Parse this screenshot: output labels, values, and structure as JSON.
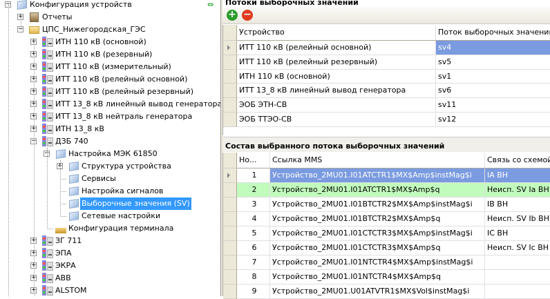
{
  "tree": {
    "nodes": [
      {
        "label": "Конфигурация устройств",
        "level": 0,
        "expander": "−",
        "icon": "cube-icon"
      },
      {
        "label": "Отчеты",
        "level": 1,
        "expander": "+",
        "icon": "reports-icon"
      },
      {
        "label": "ЦПС_Нижегородская_ГЭС",
        "level": 1,
        "expander": "−",
        "icon": "folder-icon"
      },
      {
        "label": "ИТН 110 кВ (основной)",
        "level": 2,
        "expander": "+",
        "icon": "device-icon"
      },
      {
        "label": "ИТН 110 кВ (резервный)",
        "level": 2,
        "expander": "+",
        "icon": "device-icon"
      },
      {
        "label": "ИТТ 110 кВ (измерительный)",
        "level": 2,
        "expander": "+",
        "icon": "device-icon"
      },
      {
        "label": "ИТТ 110 кВ (релейный основной)",
        "level": 2,
        "expander": "+",
        "icon": "device-icon"
      },
      {
        "label": "ИТТ 110 кВ (релейный резервный)",
        "level": 2,
        "expander": "+",
        "icon": "device-icon"
      },
      {
        "label": "ИТТ 13_8 кВ линейный вывод генератора",
        "level": 2,
        "expander": "+",
        "icon": "device-icon"
      },
      {
        "label": "ИТТ 13_8 кВ нейтраль генератора",
        "level": 2,
        "expander": "+",
        "icon": "device-icon"
      },
      {
        "label": "ИТН 13_8 кВ",
        "level": 2,
        "expander": "+",
        "icon": "device-icon"
      },
      {
        "label": "ДЗБ 740",
        "level": 2,
        "expander": "−",
        "icon": "device-icon"
      },
      {
        "label": "Настройка МЭК 61850",
        "level": 3,
        "expander": "−",
        "icon": "cube-icon"
      },
      {
        "label": "Структура устройства",
        "level": 4,
        "expander": "+",
        "icon": "cube-icon"
      },
      {
        "label": "Сервисы",
        "level": 4,
        "expander": "",
        "icon": "cube-icon"
      },
      {
        "label": "Настройка сигналов",
        "level": 4,
        "expander": "",
        "icon": "cube-icon"
      },
      {
        "label": "Выборочные значения (SV)",
        "level": 4,
        "expander": "",
        "icon": "cube-icon",
        "selected": true
      },
      {
        "label": "Сетевые настройки",
        "level": 4,
        "expander": "",
        "icon": "cube-icon"
      },
      {
        "label": "Конфигурация терминала",
        "level": 3,
        "expander": "",
        "icon": "terminal-config-icon"
      },
      {
        "label": "ЗГ 711",
        "level": 2,
        "expander": "+",
        "icon": "device-icon"
      },
      {
        "label": "ЭПА",
        "level": 2,
        "expander": "+",
        "icon": "device-icon"
      },
      {
        "label": "ЭКРА",
        "level": 2,
        "expander": "+",
        "icon": "device-icon"
      },
      {
        "label": "ABB",
        "level": 2,
        "expander": "+",
        "icon": "device-icon"
      },
      {
        "label": "ALSTOM",
        "level": 2,
        "expander": "+",
        "icon": "device-icon"
      }
    ]
  },
  "streams": {
    "title": "Потоки выборочных значений",
    "toolbar": {
      "add": "+",
      "remove": "−"
    },
    "columns": [
      "Устройство",
      "Поток выборочных значений"
    ],
    "rows": [
      [
        "ИТТ 110 кВ (релейный основной)",
        "sv4"
      ],
      [
        "ИТТ 110 кВ (релейный резервный)",
        "sv5"
      ],
      [
        "ИТН 110 кВ (основной)",
        "sv1"
      ],
      [
        "ИТТ 13_8 кВ линейный вывод генератора",
        "sv6"
      ],
      [
        "ЭОБ ЭТН-СВ",
        "sv11"
      ],
      [
        "ЭОБ ТТЭО-СВ",
        "sv12"
      ]
    ]
  },
  "composition": {
    "title": "Состав выбранного потока выборочных значений",
    "columns": [
      "Но...",
      "Ссылка MMS",
      "Связь со схемой"
    ],
    "rows": [
      [
        "1",
        "Устройство_2MU01.I01ATCTR1$MX$Amp$instMag$i",
        "IA ВН"
      ],
      [
        "2",
        "Устройство_2MU01.I01ATCTR1$MX$Amp$q",
        "Неисп. SV Ia ВН"
      ],
      [
        "3",
        "Устройство_2MU01.I01BTCTR2$MX$Amp$instMag$i",
        "IB ВН"
      ],
      [
        "4",
        "Устройство_2MU01.I01BTCTR2$MX$Amp$q",
        "Неисп. SV Ib ВН"
      ],
      [
        "5",
        "Устройство_2MU01.I01CTCTR3$MX$Amp$instMag$i",
        "IC ВН"
      ],
      [
        "6",
        "Устройство_2MU01.I01CTCTR3$MX$Amp$q",
        "Неисп. SV Ic ВН"
      ],
      [
        "7",
        "Устройство_2MU01.I01NTCTR4$MX$Amp$instMag$i",
        ""
      ],
      [
        "8",
        "Устройство_2MU01.I01NTCTR4$MX$Amp$q",
        ""
      ],
      [
        "9",
        "Устройство_2MU01.U01ATVTR1$MX$Vol$instMag$i",
        ""
      ]
    ]
  }
}
